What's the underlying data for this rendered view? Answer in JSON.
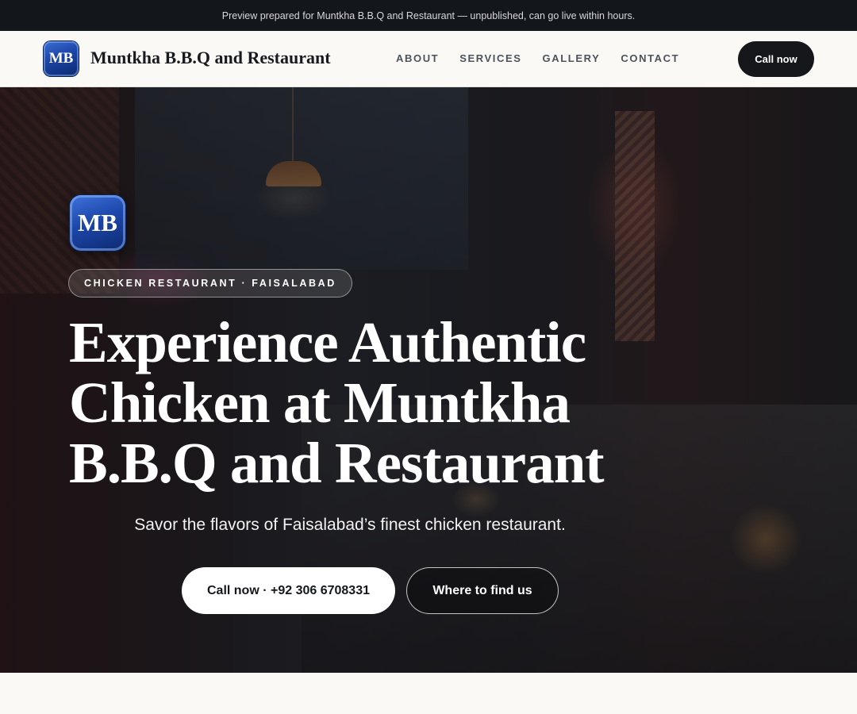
{
  "preview_banner": "Preview prepared for Muntkha B.B.Q and Restaurant — unpublished, can go live within hours.",
  "header": {
    "logo_text": "MB",
    "brand_name": "Muntkha B.B.Q and Restaurant",
    "nav": [
      {
        "label": "ABOUT"
      },
      {
        "label": "SERVICES"
      },
      {
        "label": "GALLERY"
      },
      {
        "label": "CONTACT"
      }
    ],
    "cta_label": "Call now"
  },
  "hero": {
    "logo_text": "MB",
    "eyebrow": "CHICKEN RESTAURANT · FAISALABAD",
    "headline": "Experience Authentic Chicken at Muntkha B.B.Q and Restaurant",
    "subheadline": "Savor the flavors of Faisalabad’s finest chicken restaurant.",
    "primary_cta": "Call now · +92 306 6708331",
    "secondary_cta": "Where to find us",
    "background_image": "restaurant interior with pendant lamp and set tables"
  },
  "colors": {
    "banner_bg": "#13161b",
    "nav_bg": "#faf9f6",
    "dark_button": "#15171b",
    "logo_blue": "#1b44a6"
  }
}
